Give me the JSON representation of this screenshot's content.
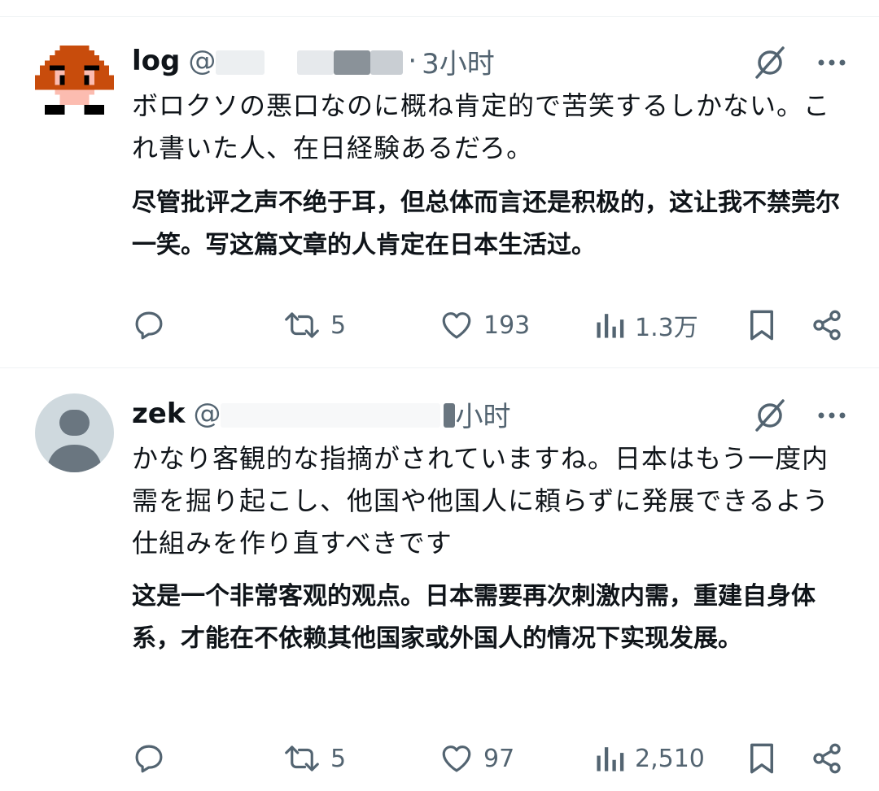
{
  "tweets": [
    {
      "name": "log",
      "handle": "@",
      "time": "3小时",
      "text": "ボロクソの悪口なのに概ね肯定的で苦笑するしかない。これ書いた人、在日経験あるだろ。",
      "translation": "尽管批评之声不绝于耳，但总体而言还是积极的，这让我不禁莞尔一笑。写这篇文章的人肯定在日本生活过。",
      "stats": {
        "replies": "",
        "reposts": "5",
        "likes": "193",
        "views": "1.3万"
      }
    },
    {
      "name": "zek",
      "handle": "@",
      "time": "小时",
      "text": "かなり客観的な指摘がされていますね。日本はもう一度内需を掘り起こし、他国や他国人に頼らずに発展できるよう仕組みを作り直すべきです",
      "translation": "这是一个非常客观的观点。日本需要再次刺激内需，重建自身体系，才能在不依赖其他国家或外国人的情况下实现发展。",
      "stats": {
        "replies": "",
        "reposts": "5",
        "likes": "97",
        "views": "2,510"
      }
    }
  ],
  "icons": {
    "reply": "reply-icon",
    "repost": "repost-icon",
    "like": "heart-icon",
    "views": "analytics-icon",
    "bookmark": "bookmark-icon",
    "share": "share-icon",
    "grok": "grok-icon",
    "more": "more-icon"
  },
  "colors": {
    "text": "#0f1419",
    "secondary": "#536471",
    "divider": "#eff3f4"
  }
}
